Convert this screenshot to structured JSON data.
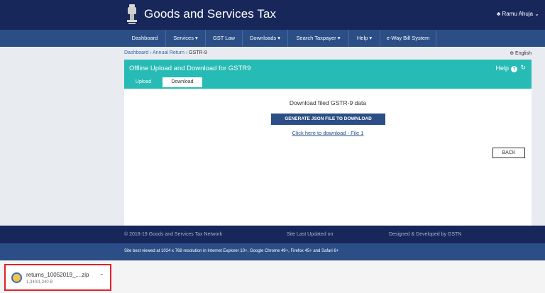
{
  "header": {
    "site_title": "Goods and Services Tax",
    "user": "♣ Ramu Ahuja ⌄"
  },
  "nav": {
    "items": [
      {
        "label": "Dashboard"
      },
      {
        "label": "Services ▾"
      },
      {
        "label": "GST Law"
      },
      {
        "label": "Downloads ▾"
      },
      {
        "label": "Search Taxpayer ▾"
      },
      {
        "label": "Help ▾"
      },
      {
        "label": "e-Way Bill System"
      }
    ]
  },
  "breadcrumb": {
    "dashboard": "Dashboard",
    "annual_return": "Annual Return",
    "current": "GSTR-9",
    "separator": "›"
  },
  "language": "⊕ English",
  "panel": {
    "title": "Offline Upload and Download for GSTR9",
    "help": "Help",
    "help_icon": "?",
    "refresh_icon": "↻",
    "tabs": [
      {
        "label": "Upload"
      },
      {
        "label": "Download"
      }
    ]
  },
  "download": {
    "title": "Download filed GSTR-9 data",
    "generate_button": "GENERATE JSON FILE TO DOWNLOAD",
    "link": "Click here to download - File 1",
    "back_button": "BACK"
  },
  "footer": {
    "copyright": "© 2018-19 Goods and Services Tax Network",
    "updated": "Site Last Updated on",
    "designed": "Designed & Developed by GSTN",
    "best_view": "Site best viewed at 1024 x 768 resolution in Internet Explorer 10+, Google Chrome 49+, Firefox 45+ and Safari 6+"
  },
  "download_shelf": {
    "file_name": "returns_10052019_....zip",
    "file_size": "1,340/1,340 B",
    "chevron": "⌃"
  },
  "colors": {
    "header_bg": "#17275a",
    "nav_bg": "#2c4e86",
    "teal": "#26bbb4",
    "highlight_border": "#e0212a"
  }
}
